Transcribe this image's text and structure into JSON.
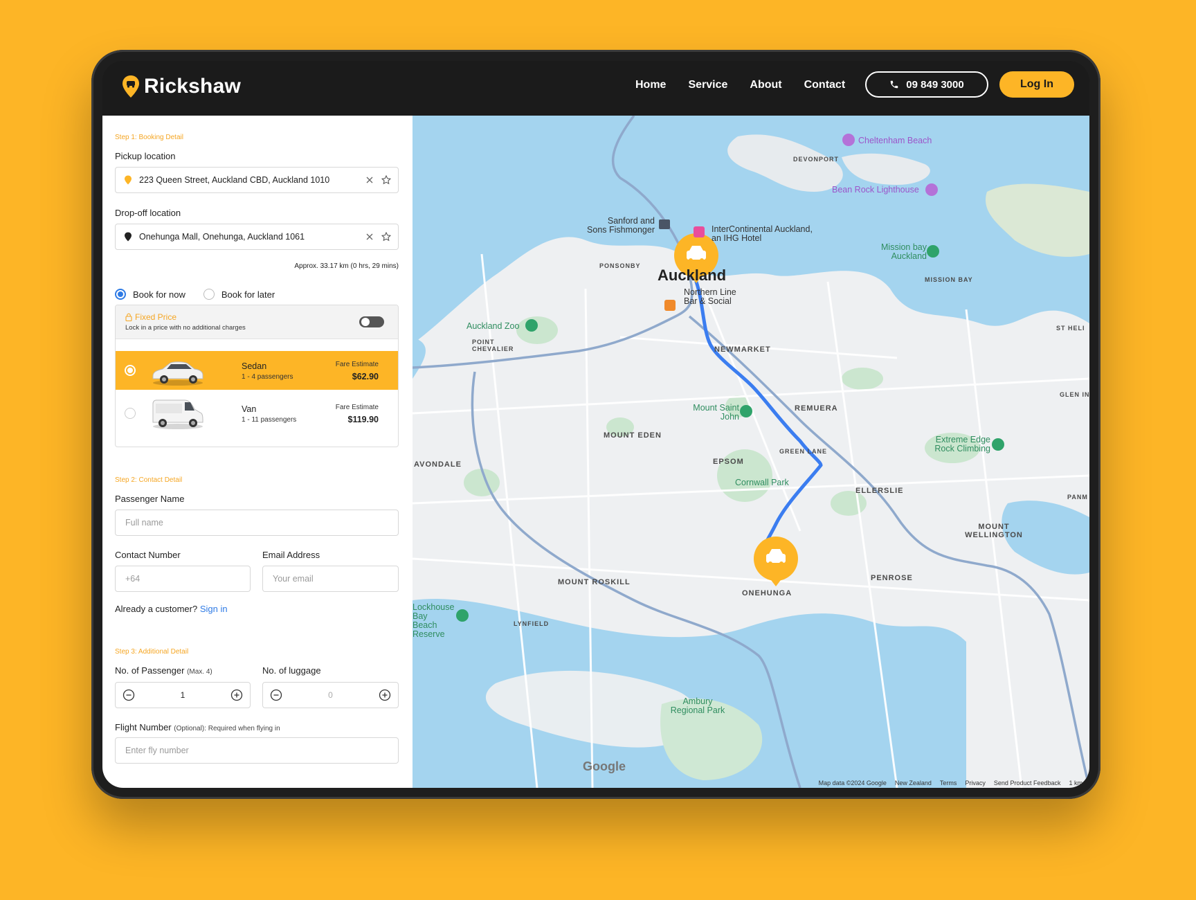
{
  "brand": {
    "name": "Rickshaw",
    "accent": "#FDB526",
    "dark": "#1b1b1b",
    "route": "#3b7df0"
  },
  "nav": [
    "Home",
    "Service",
    "About",
    "Contact"
  ],
  "header": {
    "phone": "09 849 3000",
    "login": "Log In"
  },
  "booking": {
    "step1": "Step 1: Booking Detail",
    "pickup_label": "Pickup location",
    "pickup_value": "223 Queen Street, Auckland CBD, Auckland 1010",
    "dropoff_label": "Drop-off location",
    "dropoff_value": "Onehunga Mall, Onehunga, Auckland 1061",
    "approx": "Approx. 33.17 km (0 hrs, 29 mins)",
    "book_now": "Book for now",
    "book_later": "Book for later",
    "fixed_title": "Fixed Price",
    "fixed_sub": "Lock in a price with no additional charges",
    "fare_label": "Fare Estimate",
    "vehicles": [
      {
        "name": "Sedan",
        "passengers": "1 - 4 passengers",
        "fare": "$62.90"
      },
      {
        "name": "Van",
        "passengers": "1 - 11 passengers",
        "fare": "$119.90"
      }
    ]
  },
  "contact": {
    "step2": "Step 2: Contact Detail",
    "name_label": "Passenger Name",
    "name_placeholder": "Full name",
    "phone_label": "Contact Number",
    "phone_placeholder": "+64",
    "email_label": "Email Address",
    "email_placeholder": "Your email",
    "customer_q": "Already a customer?",
    "signin": "Sign in"
  },
  "additional": {
    "step3": "Step 3: Additional Detail",
    "passenger_label": "No. of Passenger",
    "passenger_max": "(Max. 4)",
    "passenger_value": "1",
    "luggage_label": "No. of luggage",
    "luggage_value": "0",
    "flight_label": "Flight Number",
    "flight_note": "(Optional): Required when flying in",
    "flight_placeholder": "Enter fly number"
  },
  "map": {
    "areas": [
      "DEVONPORT",
      "PONSONBY",
      "NEWMARKET",
      "REMUERA",
      "MOUNT EDEN",
      "EPSOM",
      "AVONDALE",
      "ELLERSLIE",
      "MOUNT ROSKILL",
      "ONEHUNGA",
      "PENROSE",
      "MISSION BAY",
      "POINT CHEVALIER",
      "LYNFIELD",
      "GREEN LANE",
      "ST HELI",
      "GLEN IN",
      "PANM",
      "MOUNT WELLINGTON"
    ],
    "city": "Auckland",
    "places": [
      "Cheltenham Beach",
      "Bean Rock Lighthouse",
      "Sanford and Sons Fishmonger",
      "InterContinental Auckland, an IHG Hotel",
      "Mission bay Auckland",
      "Northern Line Bar & Social",
      "Auckland Zoo",
      "Mount Saint John",
      "Cornwall Park",
      "Extreme Edge Rock Climbing",
      "Lockhouse Bay Beach Reserve",
      "Ambury Regional Park"
    ],
    "footer": [
      "Map data ©2024 Google",
      "New Zealand",
      "Terms",
      "Privacy",
      "Send Product Feedback",
      "1 km"
    ],
    "logo": "Google"
  }
}
